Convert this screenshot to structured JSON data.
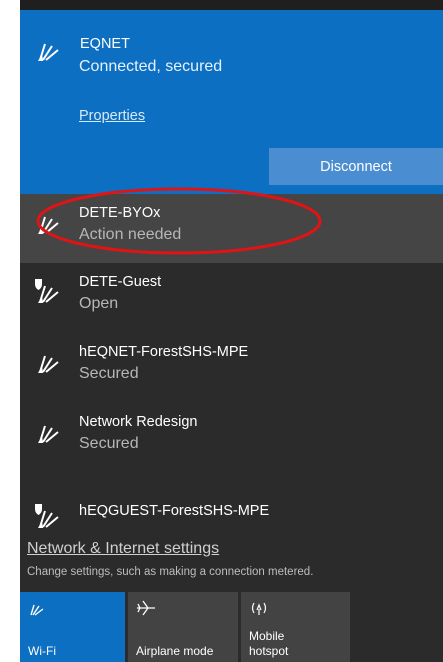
{
  "connected_network": {
    "name": "EQNET",
    "status": "Connected, secured",
    "properties_label": "Properties",
    "disconnect_label": "Disconnect"
  },
  "networks": [
    {
      "name": "DETE-BYOx",
      "status": "Action needed",
      "icon": "wifi-icon"
    },
    {
      "name": "DETE-Guest",
      "status": "Open",
      "icon": "wifi-shield-icon"
    },
    {
      "name": "hEQNET-ForestSHS-MPE",
      "status": "Secured",
      "icon": "wifi-icon"
    },
    {
      "name": "Network Redesign",
      "status": "Secured",
      "icon": "wifi-icon"
    },
    {
      "name": "hEQGUEST-ForestSHS-MPE",
      "status": "",
      "icon": "wifi-shield-icon"
    }
  ],
  "settings": {
    "link_label": "Network & Internet settings",
    "description": "Change settings, such as making a connection metered."
  },
  "quick_actions": [
    {
      "label": "Wi-Fi",
      "icon": "wifi-icon",
      "active": true
    },
    {
      "label": "Airplane mode",
      "icon": "airplane-icon",
      "active": false
    },
    {
      "label": "Mobile\nhotspot",
      "icon": "hotspot-icon",
      "active": false
    }
  ],
  "colors": {
    "accent": "#0c6fc1",
    "panel_bg": "#2b2b2b",
    "highlight_ellipse": "#e01414"
  }
}
